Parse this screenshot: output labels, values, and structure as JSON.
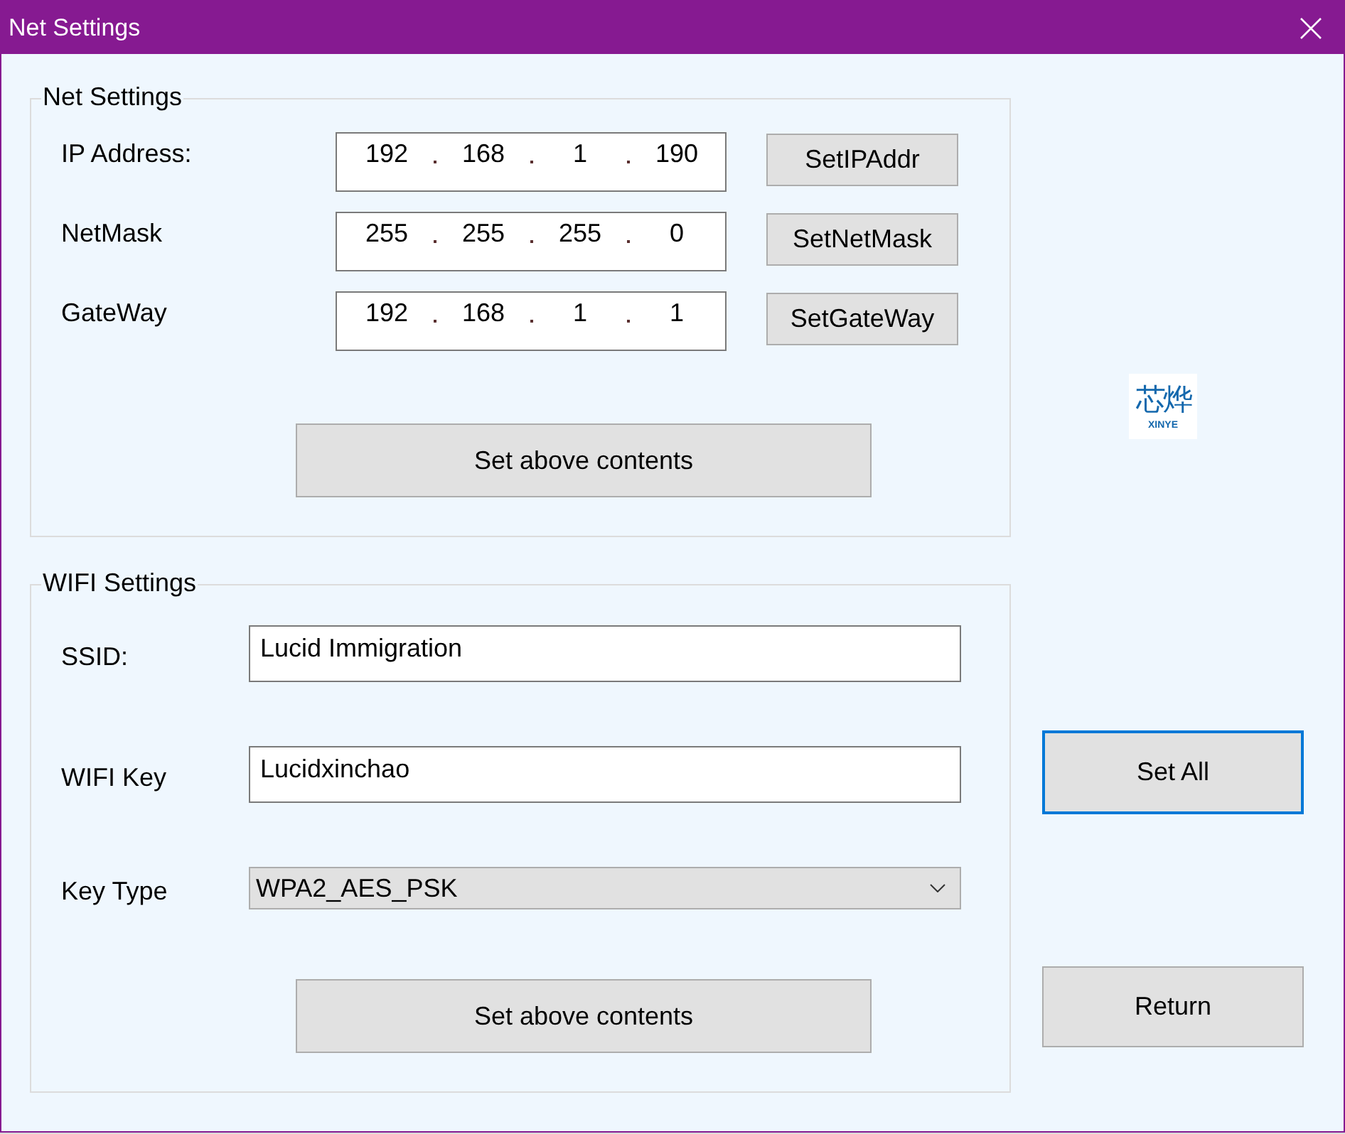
{
  "window": {
    "title": "Net Settings"
  },
  "net_settings": {
    "title": "Net Settings",
    "rows": [
      {
        "label": "IP Address:",
        "octets": [
          "192",
          "168",
          "1",
          "190"
        ],
        "button": "SetIPAddr"
      },
      {
        "label": "NetMask",
        "octets": [
          "255",
          "255",
          "255",
          "0"
        ],
        "button": "SetNetMask"
      },
      {
        "label": "GateWay",
        "octets": [
          "192",
          "168",
          "1",
          "1"
        ],
        "button": "SetGateWay"
      }
    ],
    "apply_button": "Set above contents"
  },
  "wifi_settings": {
    "title": "WIFI Settings",
    "fields": [
      {
        "kind": "text",
        "label": "SSID:",
        "value": "Lucid Immigration"
      },
      {
        "kind": "text",
        "label": "WIFI Key",
        "value": "Lucidxinchao"
      },
      {
        "kind": "dropdown",
        "label": "Key Type",
        "value": "WPA2_AES_PSK"
      }
    ],
    "apply_button": "Set above contents"
  },
  "logo": {
    "glyphs": "芯烨",
    "caption": "XINYE"
  },
  "actions": [
    {
      "label": "Set All",
      "focused": true
    },
    {
      "label": "Return",
      "focused": false
    }
  ]
}
